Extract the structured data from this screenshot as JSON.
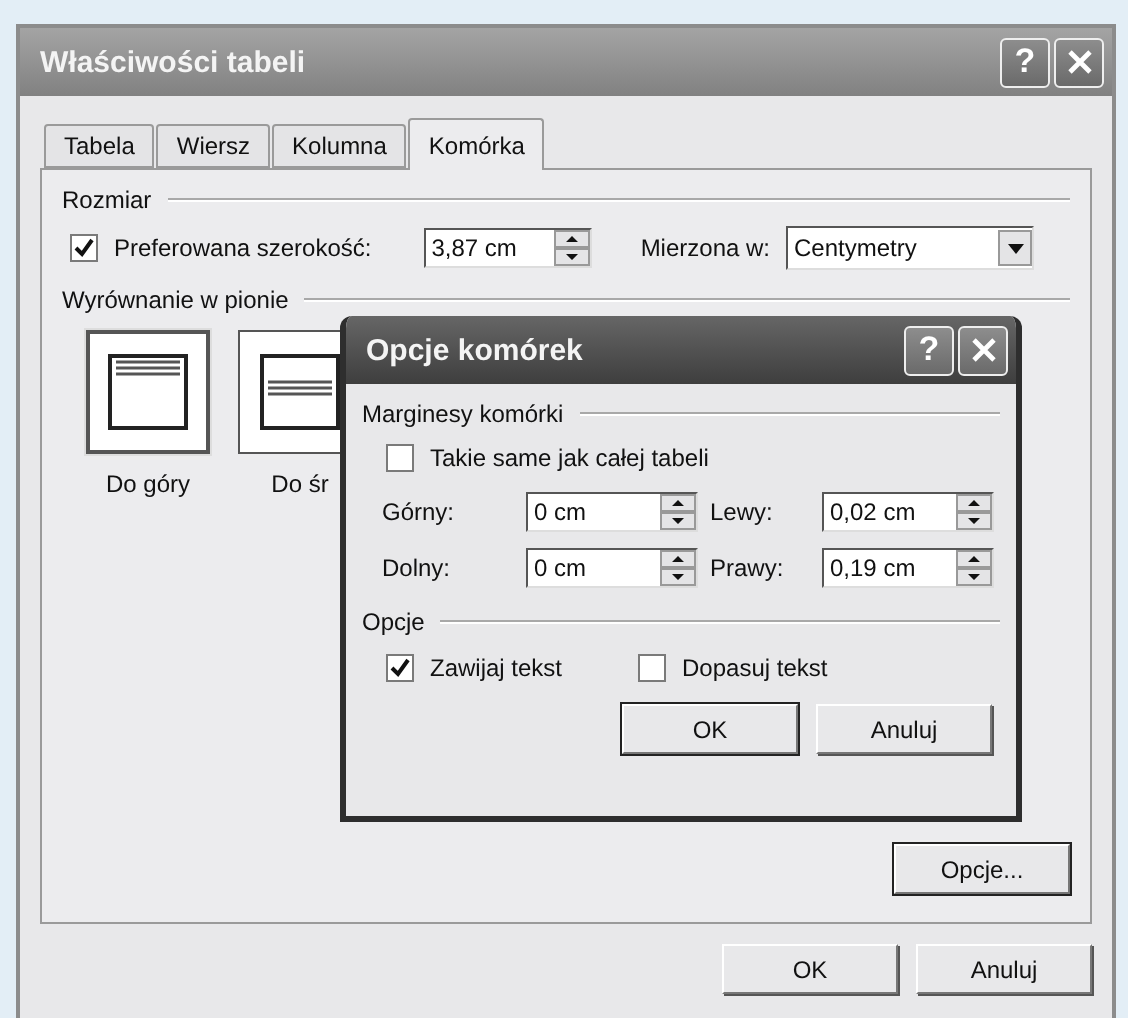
{
  "window": {
    "title": "Właściwości tabeli",
    "help": "?"
  },
  "tabs": [
    {
      "label": "Tabela",
      "selected": false
    },
    {
      "label": "Wiersz",
      "selected": false
    },
    {
      "label": "Kolumna",
      "selected": false
    },
    {
      "label": "Komórka",
      "selected": true
    }
  ],
  "size_group": {
    "label": "Rozmiar",
    "preferred_width": {
      "label": "Preferowana szerokość:",
      "checked": true,
      "value": "3,87 cm"
    },
    "measure_in": {
      "label": "Mierzona w:",
      "value": "Centymetry"
    }
  },
  "vertical_alignment": {
    "label": "Wyrównanie w pionie",
    "options": [
      {
        "label": "Do góry",
        "kind": "top",
        "selected": true
      },
      {
        "label": "Do śr",
        "kind": "middle",
        "selected": false
      }
    ]
  },
  "options_button": "Opcje...",
  "buttons": [
    "OK",
    "Anuluj"
  ],
  "cell_options_dialog": {
    "title": "Opcje komórek",
    "help": "?",
    "margins": {
      "label": "Marginesy komórki",
      "same_as_table": {
        "label": "Takie same jak całej tabeli",
        "checked": false
      },
      "fields": [
        {
          "label": "Górny:",
          "value": "0 cm"
        },
        {
          "label": "Lewy:",
          "value": "0,02 cm"
        },
        {
          "label": "Dolny:",
          "value": "0 cm"
        },
        {
          "label": "Prawy:",
          "value": "0,19 cm"
        }
      ]
    },
    "options": {
      "label": "Opcje",
      "checkboxes": [
        {
          "label": "Zawijaj tekst",
          "checked": true
        },
        {
          "label": "Dopasuj tekst",
          "checked": false
        }
      ]
    },
    "buttons": [
      "OK",
      "Anuluj"
    ]
  }
}
